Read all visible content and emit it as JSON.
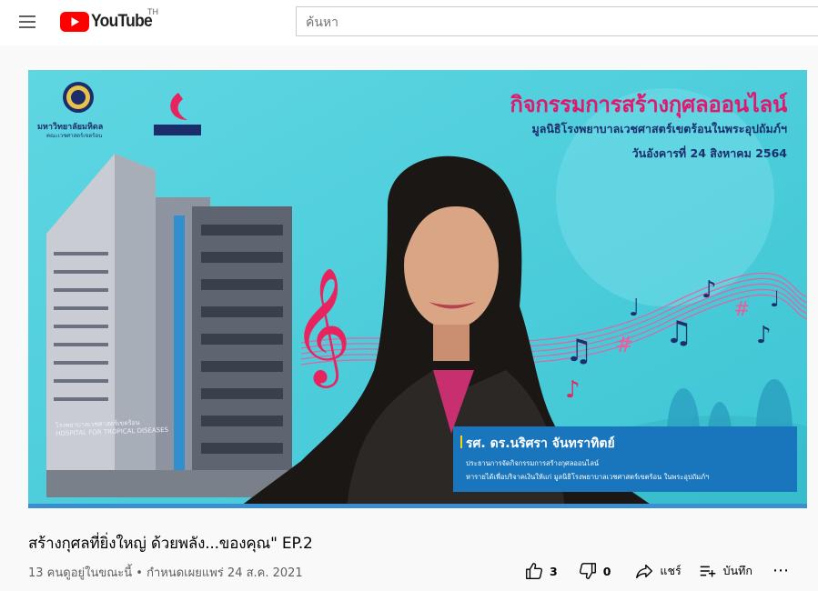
{
  "header": {
    "logo_text": "YouTube",
    "logo_region": "TH",
    "search_placeholder": "ค้นหา"
  },
  "video": {
    "overlay_title": "กิจกรรมการสร้างกุศลออนไลน์",
    "overlay_subtitle": "มูลนิธิโรงพยาบาลเวชศาสตร์เขตร้อนในพระอุปถัมภ์ฯ",
    "overlay_date": "วันอังคารที่ 24 สิงหาคม 2564",
    "org_name": "มหาวิทยาลัยมหิดล",
    "org_sub": "คณะเวชศาสตร์เขตร้อน",
    "building_sign_th": "โรงพยาบาลเวชศาสตร์เขตร้อน",
    "building_sign_en": "HOSPITAL FOR TROPICAL DISEASES",
    "speaker_name": "รศ. ดร.นริศรา จันทราทิตย์",
    "speaker_line1": "ประธานการจัดกิจกรรมการสร้างกุศลออนไลน์",
    "speaker_line2": "หารายได้เพื่อบริจาคเงินให้แก่ มูลนิธิโรงพยาบาลเวชศาสตร์เขตร้อน ในพระอุปถัมภ์ฯ"
  },
  "meta": {
    "title": "สร้างกุศลที่ยิ่งใหญ่ ด้วยพลัง...ของคุณ\" EP.2",
    "info": "13 คนดูอยู่ในขณะนี้ • กำหนดเผยแพร่ 24 ส.ค. 2021"
  },
  "actions": {
    "like_count": "3",
    "dislike_count": "0",
    "share_label": "แชร์",
    "save_label": "บันทึก",
    "more_label": "⋯"
  },
  "colors": {
    "youtube_red": "#ff0000",
    "overlay_pink": "#e0196f",
    "lower_third_blue": "#1976bd"
  }
}
